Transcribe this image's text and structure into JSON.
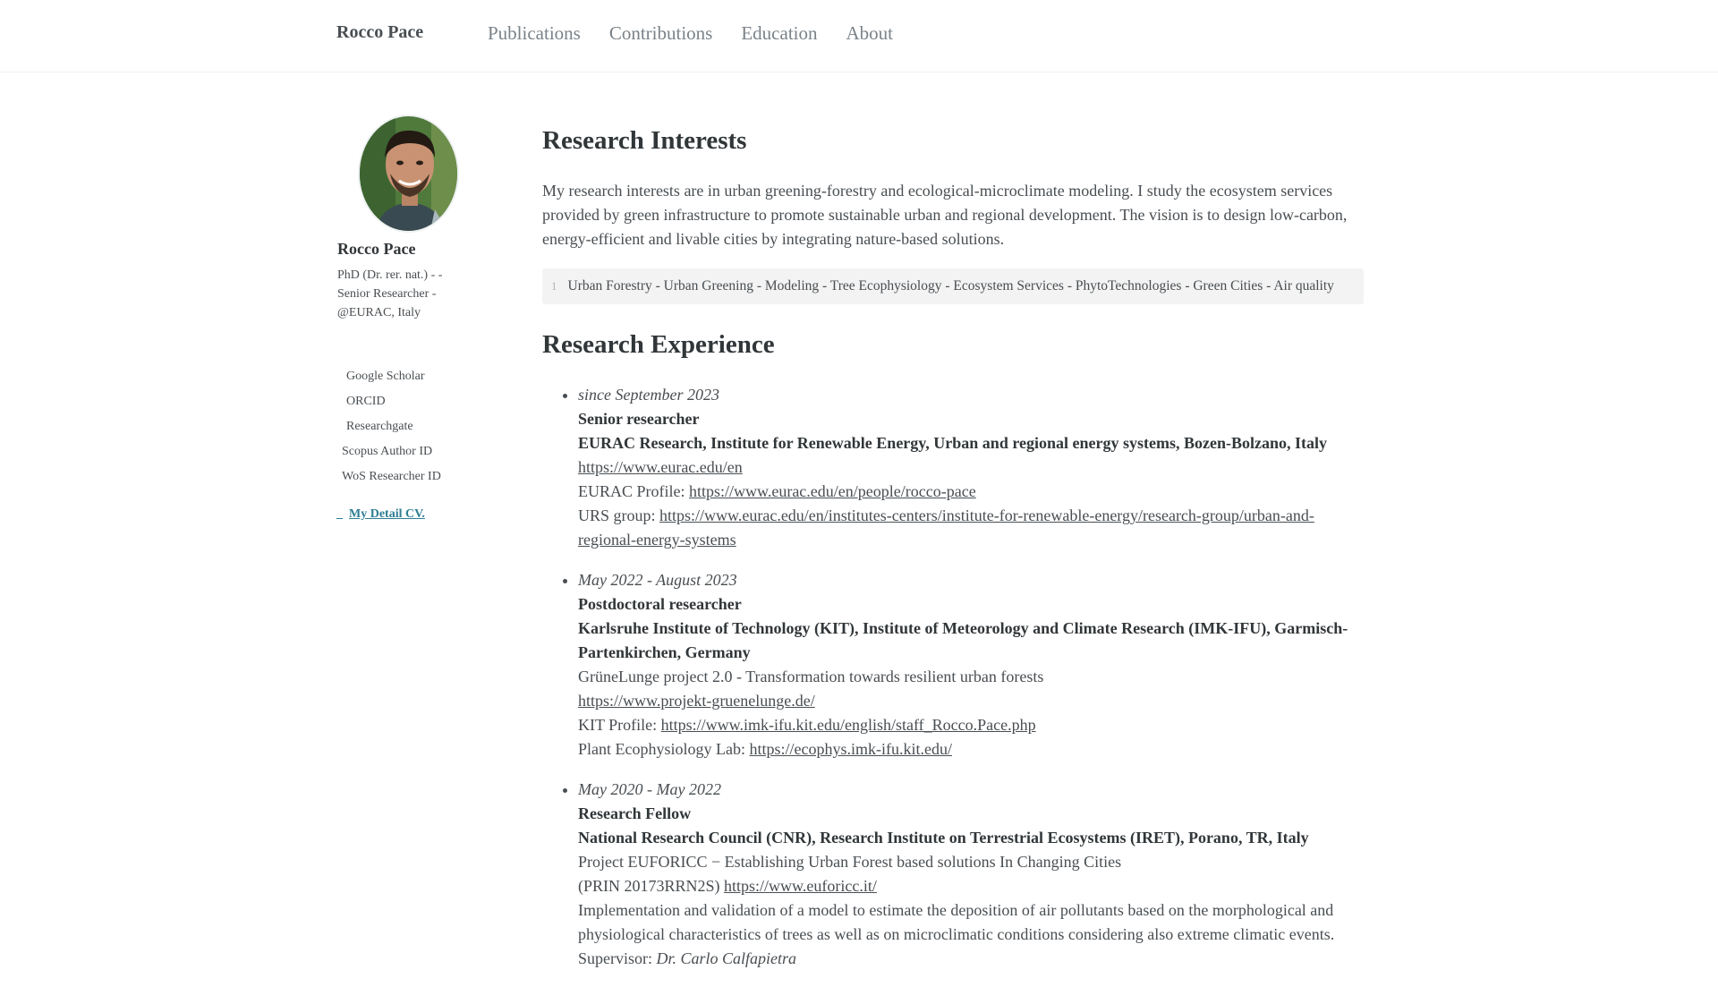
{
  "masthead": {
    "site_title": "Rocco Pace",
    "nav": [
      "Publications",
      "Contributions",
      "Education",
      "About"
    ]
  },
  "sidebar": {
    "name": "Rocco Pace",
    "bio": "PhD (Dr. rer. nat.) - - Senior Researcher - @EURAC, Italy",
    "links": [
      "Google Scholar",
      "ORCID",
      "Researchgate",
      "Scopus Author ID",
      "WoS Researcher ID"
    ],
    "cv_prefix": "_",
    "cv_label": "My Detail CV."
  },
  "interests": {
    "heading": "Research Interests",
    "text": "My research interests are in urban greening-forestry and ecological-microclimate modeling. I study the ecosystem services provided by green infrastructure to promote sustainable urban and regional development. The vision is to design low-carbon, energy-efficient and livable cities by integrating nature-based solutions.",
    "keywords_line_no": "1",
    "keywords": "Urban Forestry - Urban Greening - Modeling - Tree Ecophysiology - Ecosystem Services - PhytoTechnologies - Green Cities - Air quality"
  },
  "experience": {
    "heading": "Research Experience",
    "items": [
      {
        "date": "since September 2023",
        "role": "Senior researcher",
        "org": "EURAC Research, Institute for Renewable Energy, Urban and regional energy systems, Bozen-Bolzano, Italy",
        "url": "https://www.eurac.edu/en",
        "profile_label": "EURAC Profile:",
        "profile_url": "https://www.eurac.edu/en/people/rocco-pace",
        "group_label": "URS group:",
        "group_url": "https://www.eurac.edu/en/institutes-centers/institute-for-renewable-energy/research-group/urban-and-regional-energy-systems"
      },
      {
        "date": "May 2022 - August 2023",
        "role": "Postdoctoral researcher",
        "org": "Karlsruhe Institute of Technology (KIT), Institute of Meteorology and Climate Research (IMK-IFU), Garmisch-Partenkirchen, Germany",
        "project": "GrüneLunge project 2.0 - Transformation towards resilient urban forests",
        "url": "https://www.projekt-gruenelunge.de/",
        "profile_label": "KIT Profile:",
        "profile_url": "https://www.imk-ifu.kit.edu/english/staff_Rocco.Pace.php",
        "lab_label": "Plant Ecophysiology Lab:",
        "lab_url": "https://ecophys.imk-ifu.kit.edu/"
      },
      {
        "date": "May 2020 - May 2022",
        "role": "Research Fellow",
        "org": "National Research Council (CNR), Research Institute on Terrestrial Ecosystems (IRET), Porano, TR, Italy",
        "project": "Project EUFORICC − Establishing Urban Forest based solutions In Changing Cities",
        "prin": "(PRIN 20173RRN2S)",
        "url": "https://www.euforicc.it/",
        "description": "Implementation and validation of a model to estimate the deposition of air pollutants based on the morphological and physiological characteristics of trees as well as on microclimatic conditions considering also extreme climatic events.",
        "supervisor_label": "Supervisor:",
        "supervisor": "Dr. Carlo Calfapietra"
      }
    ]
  }
}
